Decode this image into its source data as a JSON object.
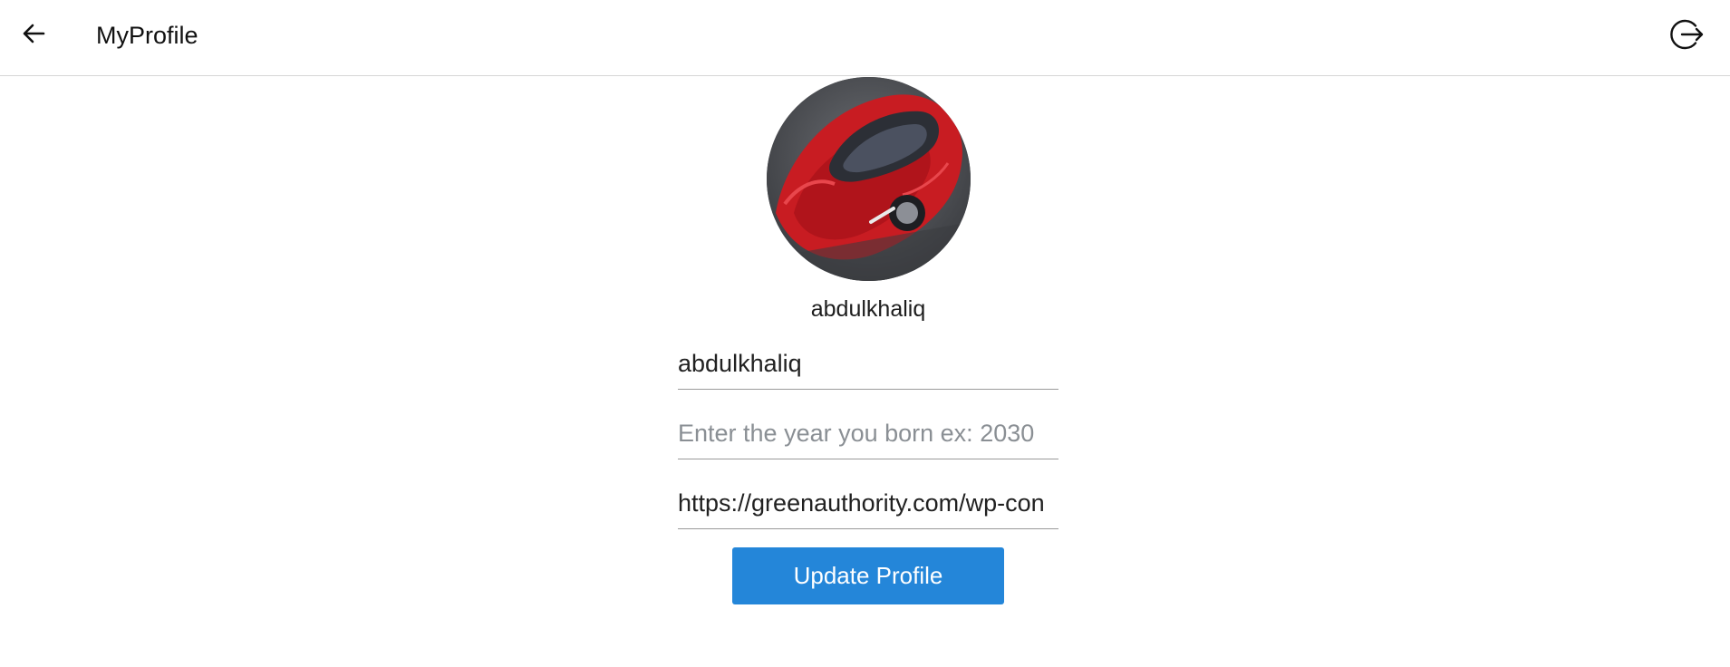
{
  "header": {
    "title": "MyProfile",
    "back_icon": "arrow-left-icon",
    "logout_icon": "logout-icon"
  },
  "profile": {
    "avatar_description": "red-sports-car-avatar",
    "username": "abdulkhaliq"
  },
  "form": {
    "username_value": "abdulkhaliq",
    "birth_year_value": "",
    "birth_year_placeholder": "Enter the year you born ex: 2030",
    "avatar_url_value": "https://greenauthority.com/wp-con",
    "submit_label": "Update Profile"
  },
  "colors": {
    "primary": "#2486d9",
    "divider": "#d6d6d6",
    "text": "#212121",
    "placeholder": "#8a8f94"
  }
}
